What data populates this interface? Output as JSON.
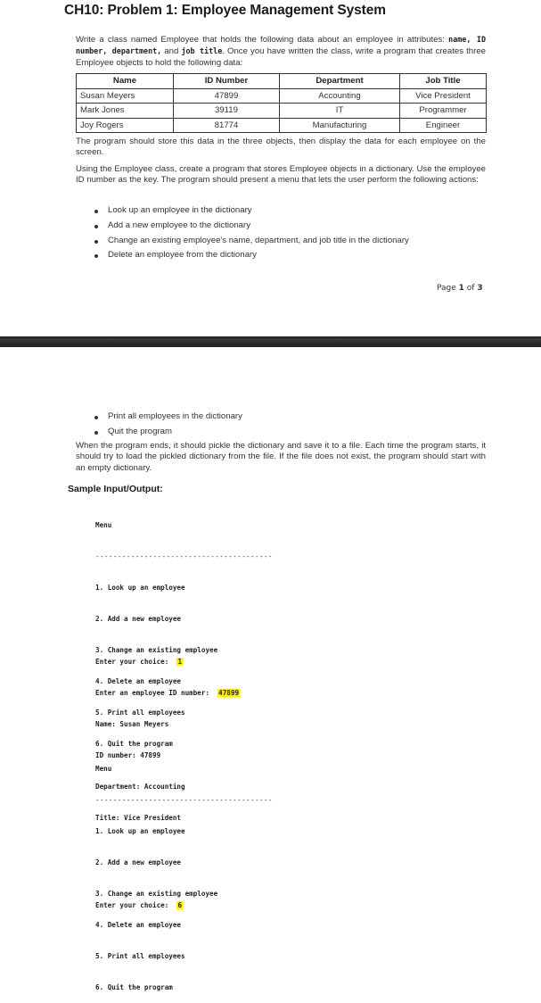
{
  "document": {
    "title": "CH10: Problem 1: Employee Management System",
    "intro_parts": [
      "Write a class named Employee that holds the following data about an employee in attributes: ",
      "name, ID number, department,",
      " and ",
      "job title",
      ". Once you have written the class, write a program that creates three Employee objects to hold the following data:"
    ],
    "table": {
      "headers": [
        "Name",
        "ID Number",
        "Department",
        "Job Title"
      ],
      "rows": [
        [
          "Susan Meyers",
          "47899",
          "Accounting",
          "Vice President"
        ],
        [
          "Mark Jones",
          "39119",
          "IT",
          "Programmer"
        ],
        [
          "Joy Rogers",
          "81774",
          "Manufacturing",
          "Engineer"
        ]
      ]
    },
    "para_store": "The program should store this data in the three objects, then display the data for each employee on the screen.",
    "para_dictionary": "Using the Employee class, create a program that stores Employee objects in a dictionary. Use the employee ID number as the key. The program should present a menu that lets the user perform the following actions:",
    "actions_page1": [
      "Look up an employee in the dictionary",
      "Add a new employee to the dictionary",
      "Change an existing employee's name, department, and job title in the dictionary",
      "Delete an employee from the dictionary"
    ],
    "page_label": {
      "prefix": "Page ",
      "current": "1",
      "middle": " of ",
      "total": "3"
    },
    "actions_page2": [
      "Print all employees in the dictionary",
      "Quit the program"
    ],
    "para_pickle": "When the program ends, it should pickle the dictionary and save it to a file. Each time the program starts, it should try to load the pickled dictionary from the file. If the file does not exist, the program should start with an empty dictionary.",
    "sample_heading": "Sample Input/Output:",
    "sample": {
      "menu_title": "Menu",
      "dashes": "----------------------------------------",
      "menu_items": [
        "1. Look up an employee",
        "2. Add a new employee",
        "3. Change an existing employee",
        "4. Delete an employee",
        "5. Print all employees",
        "6. Quit the program"
      ],
      "prompt_choice": "Enter your choice:  ",
      "choice_1": "1",
      "prompt_id": "Enter an employee ID number:  ",
      "id_input": "47899",
      "result": [
        "Name: Susan Meyers",
        "ID number: 47899",
        "Department: Accounting",
        "Title: Vice President"
      ],
      "choice_2": "6"
    },
    "highlight_color": "#fff200"
  }
}
